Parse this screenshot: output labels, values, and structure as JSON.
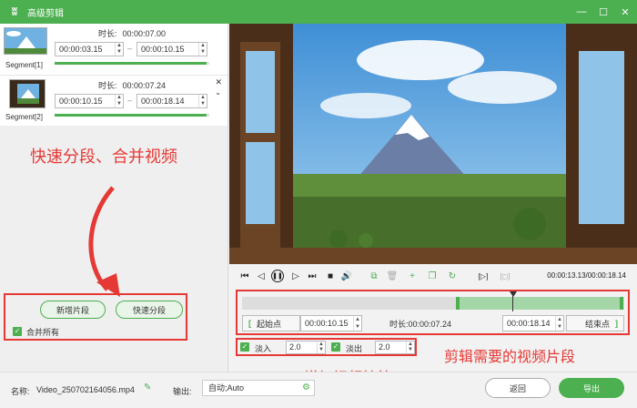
{
  "window": {
    "title": "高级剪辑",
    "minimize": "—",
    "maximize": "☐",
    "close": "✕"
  },
  "segments": [
    {
      "label": "Segment[1]",
      "duration_label": "时长:",
      "duration": "00:00:07.00",
      "start": "00:00:03.15",
      "end": "00:00:10.15",
      "dash": "–",
      "progress": 0.98
    },
    {
      "label": "Segment[2]",
      "duration_label": "时长:",
      "duration": "00:00:07.24",
      "start": "00:00:10.15",
      "end": "00:00:18.14",
      "dash": "–",
      "progress": 0.98,
      "close": "✕",
      "chevron": "⌄"
    }
  ],
  "annotations": {
    "split_merge": "快速分段、合并视频",
    "trim_segment": "剪辑需要的视频片段",
    "add_effects": "增加视频特效"
  },
  "left_actions": {
    "add_segment": "新增片段",
    "quick_split": "快速分段",
    "merge_all": "合并所有",
    "check": "✓"
  },
  "player": {
    "position_text": "00:00:13.13/00:00:18.14",
    "icons": {
      "prev": "⏮",
      "step_back": "◁",
      "play": "❚❚",
      "step_forward": "▷",
      "next": "⏭",
      "stop": "■",
      "volume": "🔊",
      "cut": "⧉",
      "delete": "🗑",
      "add": "+",
      "copy": "❐",
      "rotate": "↻",
      "mark_in": "[▷]",
      "mark_out": "[◻]"
    }
  },
  "timeline": {
    "start_btn": "起始点",
    "bracket_open": "[",
    "bracket_close": "]",
    "start_value": "00:00:10.15",
    "duration_label": "时长:",
    "duration_value": "00:00:07.24",
    "end_value": "00:00:18.14",
    "end_btn": "结束点",
    "selection_start": 0.56,
    "selection_end": 1.0,
    "playhead": 0.708
  },
  "effects": {
    "fade_in_label": "淡入",
    "fade_in_value": "2.0",
    "fade_out_label": "淡出",
    "fade_out_value": "2.0"
  },
  "footer": {
    "name_label": "名称:",
    "name_value": "Video_250702164056.mp4",
    "output_label": "输出:",
    "output_value": "自动;Auto",
    "back": "返回",
    "export": "导出"
  },
  "colors": {
    "accent": "#4caf50",
    "annotation": "#e53935"
  }
}
